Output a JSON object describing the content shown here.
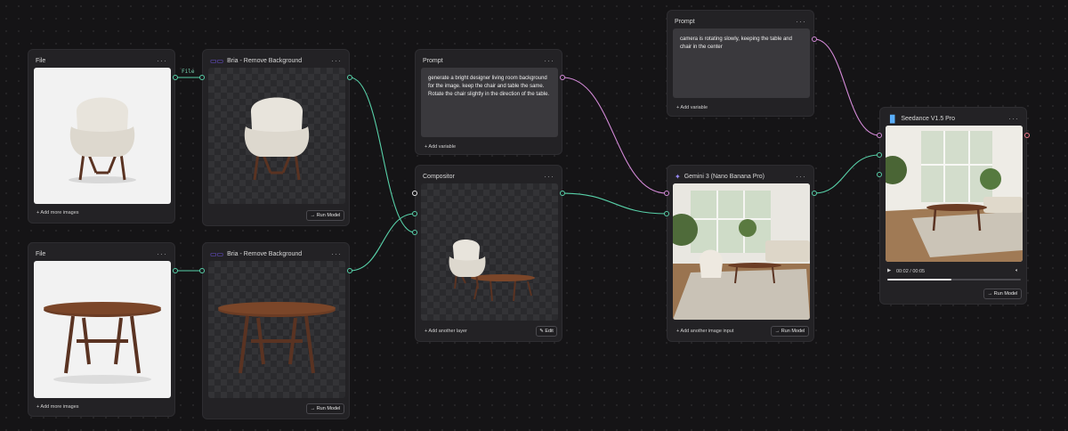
{
  "nodes": {
    "file1": {
      "title": "File",
      "footer": "+ Add more images"
    },
    "file2": {
      "title": "File",
      "footer": "+ Add more images"
    },
    "rembg1": {
      "title": "Bria - Remove Background",
      "run": "→ Run Model"
    },
    "rembg2": {
      "title": "Bria - Remove Background",
      "run": "→ Run Model"
    },
    "prompt1": {
      "title": "Prompt",
      "text": "generate a bright designer living room background for the image. keep the chair and table the same. Rotate the chair slightly in the direction of the table.",
      "footer": "+ Add variable"
    },
    "compositor": {
      "title": "Compositor",
      "footer": "+ Add another layer",
      "edit": "✎ Edit"
    },
    "prompt2": {
      "title": "Prompt",
      "text": "camera is rotating slowly, keeping the table and chair in the center",
      "footer": "+ Add variable"
    },
    "gemini": {
      "title": "Gemini 3 (Nano Banana Pro)",
      "footer": "+ Add another image input",
      "run": "→ Run Model"
    },
    "seedance": {
      "title": "Seedance V1.5 Pro",
      "time": "00:02 / 00:05",
      "run": "→ Run Model",
      "progress": 0.48
    }
  },
  "edge_label": "File",
  "icons": {
    "more": "more-icon",
    "play": "play-icon",
    "volume": "volume-icon",
    "sparkle": "sparkle-icon"
  },
  "colors": {
    "image_port": "#57d0a8",
    "text_port": "#d48ad8",
    "video_port": "#f07a8a",
    "accent": "#7c5cff"
  }
}
